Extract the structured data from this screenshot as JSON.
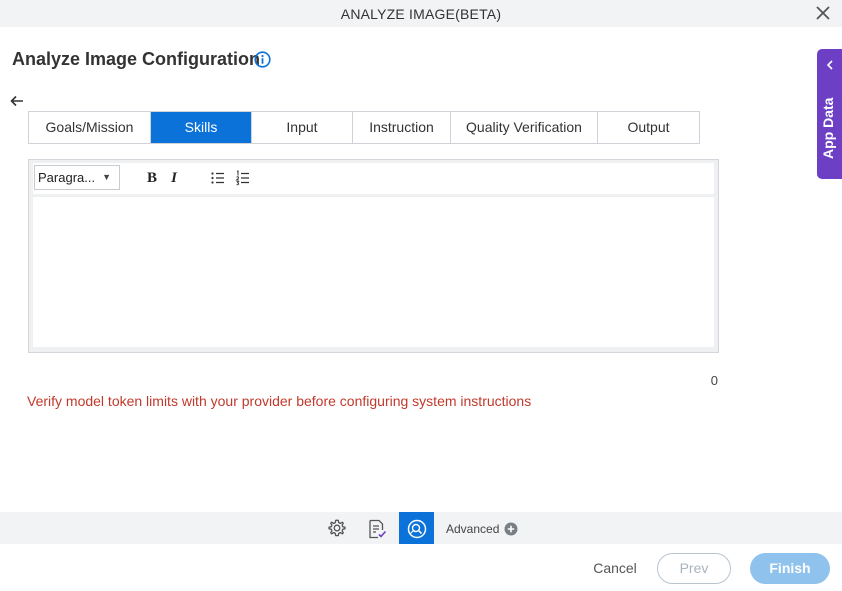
{
  "window": {
    "title": "ANALYZE IMAGE(BETA)"
  },
  "page": {
    "heading": "Analyze Image Configuration"
  },
  "tabs": [
    {
      "label": "Goals/Mission",
      "active": false
    },
    {
      "label": "Skills",
      "active": true
    },
    {
      "label": "Input",
      "active": false
    },
    {
      "label": "Instruction",
      "active": false
    },
    {
      "label": "Quality Verification",
      "active": false
    },
    {
      "label": "Output",
      "active": false
    }
  ],
  "editor": {
    "format_select": "Paragra...",
    "bold_label": "B",
    "italic_label": "I",
    "content": "",
    "char_count": "0"
  },
  "warning": "Verify model token limits with your provider before configuring system instructions",
  "footer": {
    "advanced_label": "Advanced"
  },
  "actions": {
    "cancel": "Cancel",
    "prev": "Prev",
    "finish": "Finish"
  },
  "side_panel": {
    "label": "App Data"
  },
  "colors": {
    "accent": "#0b72d9",
    "side_panel": "#6d3fc4",
    "warning": "#c0392b",
    "finish_disabled": "#8fc2ec"
  },
  "icons": [
    "close-icon",
    "info-icon",
    "back-arrow-icon",
    "bullet-list-icon",
    "numbered-list-icon",
    "settings-gear-icon",
    "document-check-icon",
    "image-search-icon",
    "plus-circle-icon",
    "chevron-left-icon"
  ]
}
